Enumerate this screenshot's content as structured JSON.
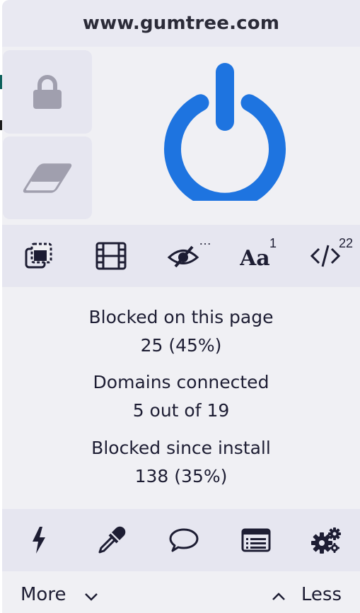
{
  "popup": {
    "hostname": "www.gumtree.com"
  },
  "side_tools": [
    {
      "icon": "lock-icon"
    },
    {
      "icon": "eraser-icon"
    }
  ],
  "power": {
    "icon": "power-icon",
    "state": "on",
    "color": "#1e74e0"
  },
  "toolbar": {
    "tools": [
      {
        "icon": "popup-block-icon",
        "badge": ""
      },
      {
        "icon": "media-block-icon",
        "badge": ""
      },
      {
        "icon": "cosmetic-filter-icon",
        "badge": "…"
      },
      {
        "icon": "remote-fonts-icon",
        "badge": "1"
      },
      {
        "icon": "javascript-icon",
        "badge": "22"
      }
    ]
  },
  "stats": {
    "blocked_page_label": "Blocked on this page",
    "blocked_page_value": "25 (45%)",
    "domains_label": "Domains connected",
    "domains_value": "5 out of 19",
    "blocked_install_label": "Blocked since install",
    "blocked_install_value": "138 (35%)"
  },
  "bottom_tools": [
    {
      "icon": "lightning-icon"
    },
    {
      "icon": "eyedropper-icon"
    },
    {
      "icon": "speech-bubble-icon"
    },
    {
      "icon": "logger-list-icon"
    },
    {
      "icon": "settings-gears-icon"
    }
  ],
  "footer": {
    "more_label": "More",
    "less_label": "Less"
  },
  "colors": {
    "accent": "#1e74e0",
    "panel_bg": "#f0f0f4",
    "toolbar_bg": "#e6e6f0",
    "text": "#1d1d33",
    "disabled_icon": "#a09fae"
  }
}
